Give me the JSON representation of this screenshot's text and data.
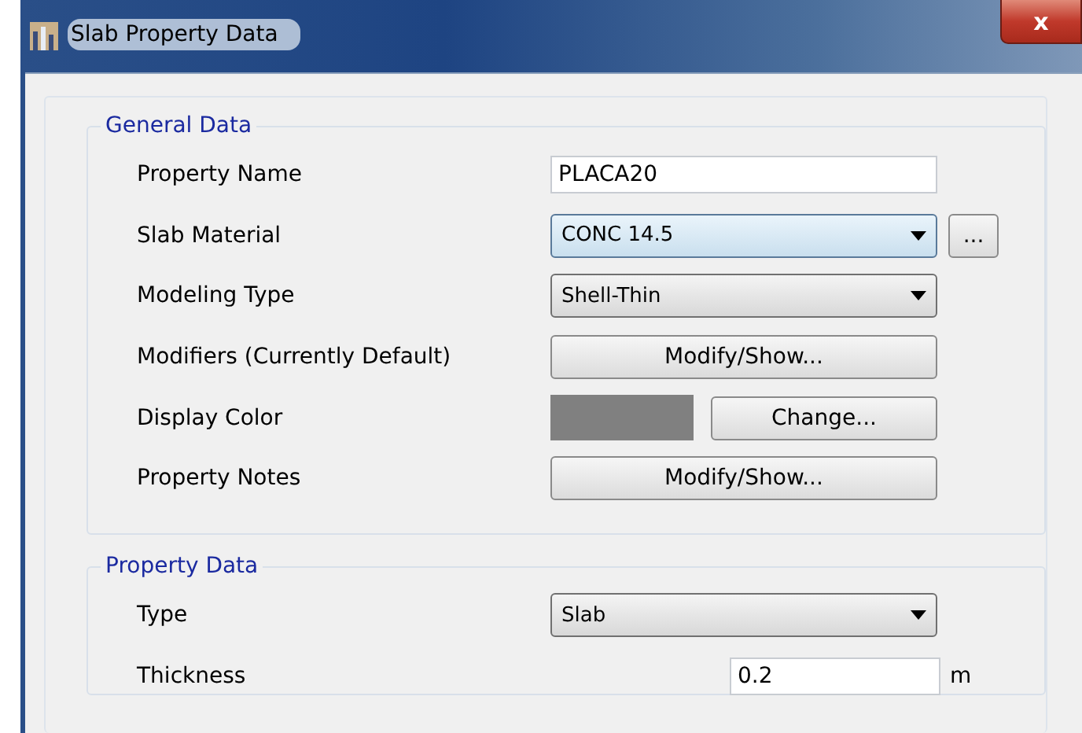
{
  "window": {
    "title": "Slab Property Data",
    "close": "x"
  },
  "general_data": {
    "title": "General Data",
    "rows": [
      {
        "label": "Property Name",
        "kind": "text",
        "value": "PLACA20"
      },
      {
        "label": "Slab Material",
        "kind": "dropdown",
        "value": "CONC 14.5",
        "focused": true,
        "extra_button": "..."
      },
      {
        "label": "Modeling Type",
        "kind": "dropdown",
        "value": "Shell-Thin",
        "focused": false
      },
      {
        "label": "Modifiers (Currently Default)",
        "kind": "button",
        "button": "Modify/Show..."
      },
      {
        "label": "Display Color",
        "kind": "color",
        "color": "#808080",
        "button": "Change..."
      },
      {
        "label": "Property Notes",
        "kind": "button",
        "button": "Modify/Show..."
      }
    ]
  },
  "property_data": {
    "title": "Property Data",
    "rows": [
      {
        "label": "Type",
        "kind": "dropdown",
        "value": "Slab",
        "focused": false
      },
      {
        "label": "Thickness",
        "kind": "number",
        "value": "0.2",
        "unit": "m"
      }
    ]
  }
}
